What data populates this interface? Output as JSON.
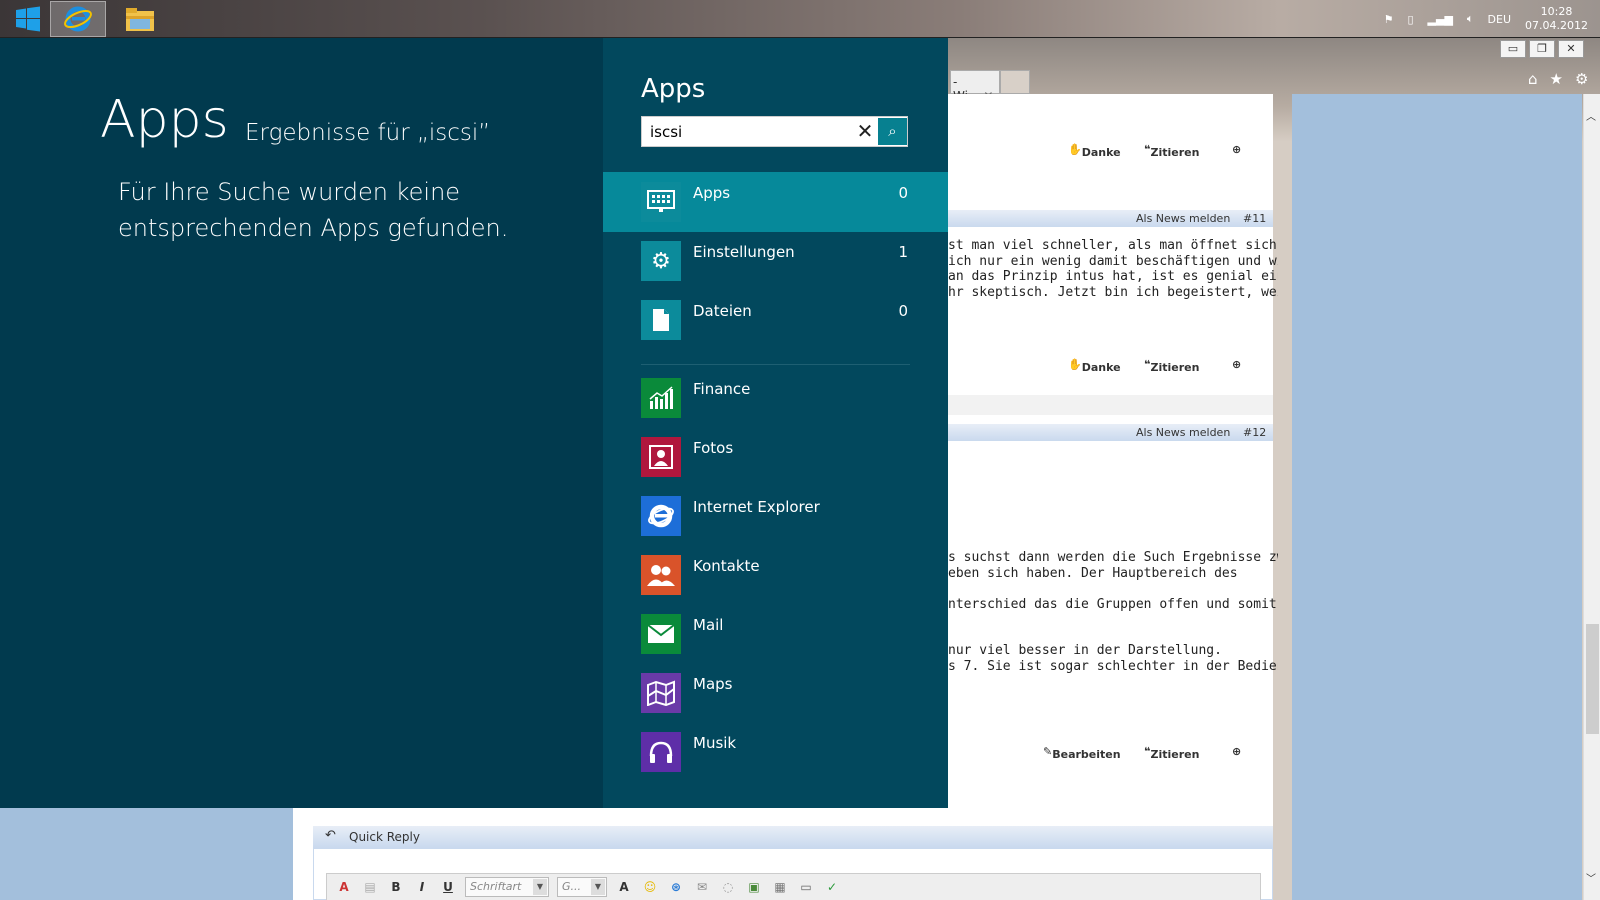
{
  "taskbar": {
    "tray_lang": "DEU",
    "clock_time": "10:28",
    "clock_date": "07.04.2012"
  },
  "browser": {
    "tab_fragment": "- Wi...",
    "tab_close": "✕",
    "posts": [
      {
        "actions": [
          "Danke",
          "Zitieren"
        ]
      },
      {
        "news_label": "Als News melden",
        "number": "#11",
        "text": "st man viel schneller, als man öffnet sich das\nich nur ein wenig damit beschäftigen und wie\nan das Prinzip intus hat, ist es genial einfach.\nhr skeptisch. Jetzt bin ich begeistert, weil ich",
        "actions": [
          "Danke",
          "Zitieren"
        ]
      },
      {
        "news_label": "Als News melden",
        "number": "#12",
        "text": "s suchst dann werden die Such Ergebnisse zwar\neben sich haben. Der Hauptbereich des\n\nnterschied das die Gruppen offen und somit\n\n\nnur viel besser in der Darstellung.\ns 7. Sie ist sogar schlechter in der Bedienung.",
        "actions": [
          "Bearbeiten",
          "Zitieren"
        ]
      }
    ],
    "quick_reply": {
      "label": "Quick Reply",
      "font_placeholder": "Schriftart",
      "size_placeholder": "G..."
    }
  },
  "search": {
    "results_title": "Apps",
    "results_subtitle": "Ergebnisse für „iscsi”",
    "no_results": "Für Ihre Suche wurden keine entsprechenden Apps gefunden.",
    "pane_title": "Apps",
    "query": "iscsi",
    "categories": [
      {
        "label": "Apps",
        "count": "0",
        "icon": "apps-grid-icon",
        "selected": true
      },
      {
        "label": "Einstellungen",
        "count": "1",
        "icon": "gear-icon",
        "selected": false
      },
      {
        "label": "Dateien",
        "count": "0",
        "icon": "document-icon",
        "selected": false
      }
    ],
    "apps": [
      {
        "label": "Finance",
        "icon": "finance-chart-icon",
        "color": "#0a8a3a"
      },
      {
        "label": "Fotos",
        "icon": "photo-icon",
        "color": "#b0173d"
      },
      {
        "label": "Internet Explorer",
        "icon": "internet-explorer-icon",
        "color": "#1d6ed8"
      },
      {
        "label": "Kontakte",
        "icon": "people-icon",
        "color": "#d9532a"
      },
      {
        "label": "Mail",
        "icon": "mail-icon",
        "color": "#0a8a3a"
      },
      {
        "label": "Maps",
        "icon": "map-icon",
        "color": "#6a3aa8"
      },
      {
        "label": "Musik",
        "icon": "headphones-icon",
        "color": "#5e2ea8"
      }
    ]
  }
}
